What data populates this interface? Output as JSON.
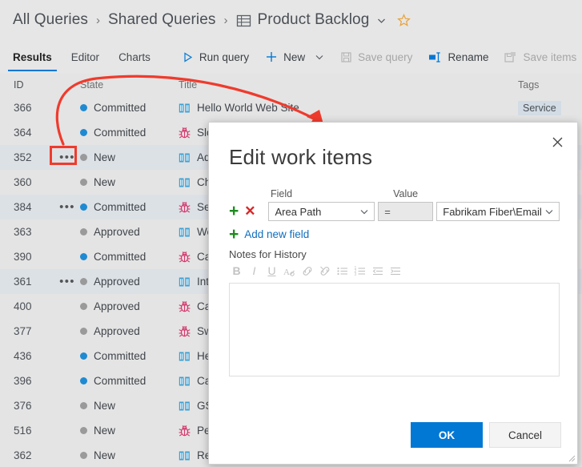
{
  "breadcrumb": {
    "items": [
      {
        "label": "All Queries",
        "icon": null
      },
      {
        "label": "Shared Queries",
        "icon": null
      },
      {
        "label": "Product Backlog",
        "icon": "grid-table-icon"
      }
    ],
    "separator": "›",
    "chevron": "chevron-down-icon",
    "favorite": "star-icon",
    "favorite_color": "#e8a33d"
  },
  "toolbar": {
    "tabs": [
      {
        "label": "Results",
        "active": true
      },
      {
        "label": "Editor",
        "active": false
      },
      {
        "label": "Charts",
        "active": false
      }
    ],
    "buttons": [
      {
        "label": "Run query",
        "icon": "play-triangle-icon",
        "disabled": false
      },
      {
        "label": "New",
        "icon": "plus-icon",
        "disabled": false,
        "caret": true
      },
      {
        "label": "Save query",
        "icon": "save-disk-icon",
        "disabled": true
      },
      {
        "label": "Rename",
        "icon": "rename-icon",
        "disabled": false
      },
      {
        "label": "Save items",
        "icon": "save-items-icon",
        "disabled": true
      }
    ],
    "accent_color": "#0078d4"
  },
  "grid": {
    "columns": [
      "ID",
      "State",
      "Title",
      "Tags"
    ],
    "rows": [
      {
        "id": "366",
        "dots": false,
        "state": "Committed",
        "state_color": "blue",
        "icon": "book-feature-icon",
        "title": "Hello World Web Site",
        "tags": "Service",
        "selected": false
      },
      {
        "id": "364",
        "dots": false,
        "state": "Committed",
        "state_color": "blue",
        "icon": "bug-icon",
        "title": "Slo",
        "tags": "",
        "selected": false
      },
      {
        "id": "352",
        "dots": true,
        "state": "New",
        "state_color": "gray",
        "icon": "book-feature-icon",
        "title": "Ad",
        "tags": "",
        "selected": true
      },
      {
        "id": "360",
        "dots": false,
        "state": "New",
        "state_color": "gray",
        "icon": "book-feature-icon",
        "title": "Ch",
        "tags": "",
        "selected": false
      },
      {
        "id": "384",
        "dots": true,
        "state": "Committed",
        "state_color": "blue",
        "icon": "bug-icon",
        "title": "Se",
        "tags": "",
        "selected": true
      },
      {
        "id": "363",
        "dots": false,
        "state": "Approved",
        "state_color": "gray",
        "icon": "book-feature-icon",
        "title": "We",
        "tags": "",
        "selected": false
      },
      {
        "id": "390",
        "dots": false,
        "state": "Committed",
        "state_color": "blue",
        "icon": "bug-icon",
        "title": "Ca",
        "tags": "",
        "selected": false
      },
      {
        "id": "361",
        "dots": true,
        "state": "Approved",
        "state_color": "gray",
        "icon": "book-feature-icon",
        "title": "Int",
        "tags": "",
        "selected": true
      },
      {
        "id": "400",
        "dots": false,
        "state": "Approved",
        "state_color": "gray",
        "icon": "bug-icon",
        "title": "Ca",
        "tags": "",
        "selected": false
      },
      {
        "id": "377",
        "dots": false,
        "state": "Approved",
        "state_color": "gray",
        "icon": "bug-icon",
        "title": "Sw",
        "tags": "",
        "selected": false
      },
      {
        "id": "436",
        "dots": false,
        "state": "Committed",
        "state_color": "blue",
        "icon": "book-feature-icon",
        "title": "He",
        "tags": "",
        "selected": false
      },
      {
        "id": "396",
        "dots": false,
        "state": "Committed",
        "state_color": "blue",
        "icon": "book-feature-icon",
        "title": "Ca",
        "tags": "",
        "selected": false
      },
      {
        "id": "376",
        "dots": false,
        "state": "New",
        "state_color": "gray",
        "icon": "book-feature-icon",
        "title": "GS",
        "tags": "",
        "selected": false
      },
      {
        "id": "516",
        "dots": false,
        "state": "New",
        "state_color": "gray",
        "icon": "bug-icon",
        "title": "Per",
        "tags": "",
        "selected": false
      },
      {
        "id": "362",
        "dots": false,
        "state": "New",
        "state_color": "gray",
        "icon": "book-feature-icon",
        "title": "Res",
        "tags": "",
        "selected": false
      }
    ],
    "ellipsis_glyph": "•••",
    "row_selected_bg": "#dce1e6",
    "row_bg": "#e4e4e4"
  },
  "annotation": {
    "color": "#ef3b2d",
    "highlight_target": "row-actions-ellipsis-352",
    "arrow": "curved-arrow-pointing-to-dialog"
  },
  "dialog": {
    "title": "Edit work items",
    "close_icon": "close-icon",
    "labels": {
      "field": "Field",
      "value": "Value"
    },
    "rule": {
      "add_icon": "plus-icon",
      "remove_icon": "x-remove-icon",
      "field": "Area Path",
      "operator": "=",
      "value": "Fabrikam Fiber\\Email",
      "field_caret": "chevron-down-icon",
      "value_caret": "chevron-down-icon"
    },
    "add_new_field": {
      "label": "Add new field",
      "icon": "plus-icon",
      "color": "#106ebe"
    },
    "notes_label": "Notes for History",
    "notes_value": "",
    "rte_buttons": [
      {
        "name": "bold-icon",
        "glyph": "B"
      },
      {
        "name": "italic-icon",
        "glyph": "I"
      },
      {
        "name": "underline-icon",
        "glyph": "U"
      },
      {
        "name": "clear-format-icon",
        "glyph": "Aₐ"
      },
      {
        "name": "link-icon",
        "glyph": "🔗"
      },
      {
        "name": "unlink-icon",
        "glyph": "🔗"
      },
      {
        "name": "bullet-list-icon",
        "glyph": "☰"
      },
      {
        "name": "numbered-list-icon",
        "glyph": "☰"
      },
      {
        "name": "decrease-indent-icon",
        "glyph": "⇤"
      },
      {
        "name": "increase-indent-icon",
        "glyph": "⇥"
      }
    ],
    "buttons": {
      "ok": "OK",
      "cancel": "Cancel"
    },
    "ok_color": "#0078d4",
    "resize_grip": "resize-grip-icon"
  }
}
